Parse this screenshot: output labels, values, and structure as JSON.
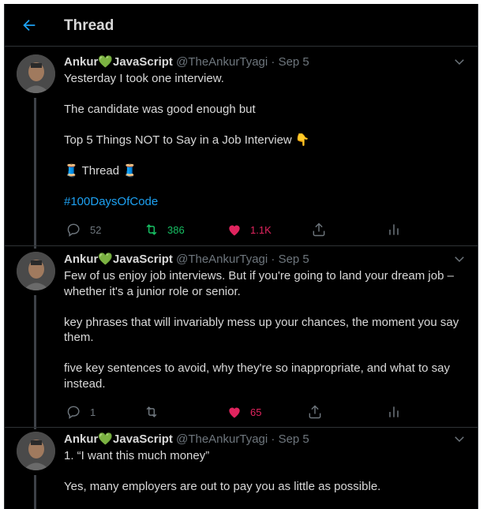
{
  "header": {
    "title": "Thread"
  },
  "tweets": [
    {
      "name": "Ankur",
      "name_suffix": "JavaScript",
      "name_emoji": "💚",
      "handle": "@TheAnkurTyagi",
      "dot": "·",
      "date": "Sep 5",
      "lines": [
        "Yesterday I took one interview.",
        "The candidate was good enough but",
        "Top 5 Things NOT to Say in a Job Interview 👇",
        "🧵 Thread 🧵",
        "#100DaysOfCode"
      ],
      "replies": "52",
      "retweets": "386",
      "likes": "1.1K"
    },
    {
      "name": "Ankur",
      "name_suffix": "JavaScript",
      "name_emoji": "💚",
      "handle": "@TheAnkurTyagi",
      "dot": "·",
      "date": "Sep 5",
      "paragraphs": [
        "Few of us enjoy job interviews. But if you're going to land your dream job – whether it's a junior role or senior.",
        "key phrases that will invariably mess up your chances, the moment you say them.",
        "five key sentences to avoid, why they're so inappropriate, and what to say instead."
      ],
      "replies": "1",
      "retweets": "",
      "likes": "65"
    },
    {
      "name": "Ankur",
      "name_suffix": "JavaScript",
      "name_emoji": "💚",
      "handle": "@TheAnkurTyagi",
      "dot": "·",
      "date": "Sep 5",
      "paragraphs": [
        "1. “I want this much money”",
        "Yes, many employers are out to pay you as little as possible."
      ]
    }
  ],
  "colors": {
    "background": "#000000",
    "text": "#d9d9d9",
    "muted": "#6e767d",
    "accent": "#1da1f2",
    "retweet": "#17bf63",
    "like": "#e0245e",
    "border": "#2f3336"
  },
  "icons": [
    "back-arrow-icon",
    "chevron-down-icon",
    "reply-icon",
    "retweet-icon",
    "heart-icon",
    "share-icon",
    "analytics-icon"
  ]
}
